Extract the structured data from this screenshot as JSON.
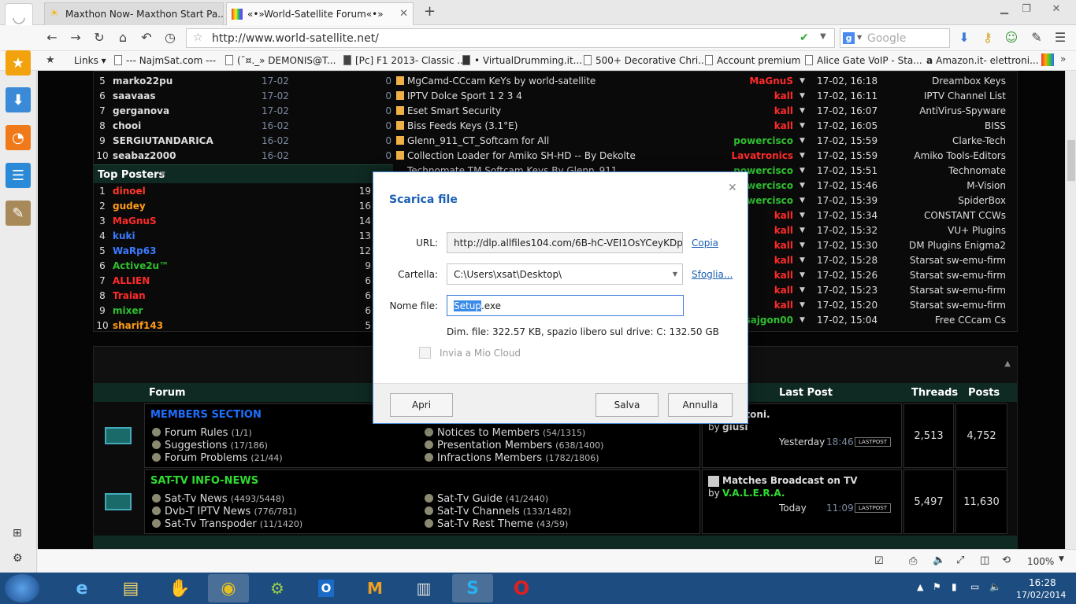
{
  "tabs": [
    {
      "title": "Maxthon Now- Maxthon Start Pa..."
    },
    {
      "title": "«•»World-Satellite Forum«•»"
    }
  ],
  "address": {
    "url": "http://www.world-satellite.net/"
  },
  "search": {
    "placeholder": "Google"
  },
  "bookmarks": [
    "Links",
    "--- NajmSat.com ---",
    "(¯¤._» DEMONIS@T...",
    "[Pc] F1 2013- Classic ...",
    "• VirtualDrumming.it...",
    "500+ Decorative Chri...",
    "Account premium",
    "Alice Gate VoIP - Sta...",
    "Amazon.it- elettroni..."
  ],
  "latest_rows": [
    {
      "num": "5",
      "user": "marko22pu",
      "date": "17-02",
      "count": "0",
      "topic": "MgCamd-CCcam KeYs by world-satellite",
      "poster": "MaGnuS",
      "poster_color": "#ff2a2a",
      "time": "17-02, 16:18",
      "forum": "Dreambox Keys"
    },
    {
      "num": "6",
      "user": "saavaas",
      "date": "17-02",
      "count": "0",
      "topic": "IPTV Dolce Sport 1 2 3 4",
      "poster": "kall",
      "poster_color": "#ff2a2a",
      "time": "17-02, 16:11",
      "forum": "IPTV Channel List"
    },
    {
      "num": "7",
      "user": "gerganova",
      "date": "17-02",
      "count": "0",
      "topic": "Eset Smart Security",
      "poster": "kall",
      "poster_color": "#ff2a2a",
      "time": "17-02, 16:07",
      "forum": "AntiVirus-Spyware"
    },
    {
      "num": "8",
      "user": "chooi",
      "date": "16-02",
      "count": "0",
      "topic": "Biss Feeds Keys (3.1°E)",
      "poster": "kall",
      "poster_color": "#ff2a2a",
      "time": "17-02, 16:05",
      "forum": "BISS"
    },
    {
      "num": "9",
      "user": "SERGIUTANDARICA",
      "date": "16-02",
      "count": "0",
      "topic": "Glenn_911_CT_Softcam for All",
      "poster": "powercisco",
      "poster_color": "#2fbf2f",
      "time": "17-02, 15:59",
      "forum": "Clarke-Tech"
    },
    {
      "num": "10",
      "user": "seabaz2000",
      "date": "16-02",
      "count": "0",
      "topic": "Collection Loader for Amiko SH-HD -- By Dekolte",
      "poster": "Lavatronics",
      "poster_color": "#ff2a2a",
      "time": "17-02, 15:59",
      "forum": "Amiko Tools-Editors"
    }
  ],
  "top_posters_title": "Top Posters",
  "top_posters": [
    {
      "num": "1",
      "name": "dinoel",
      "color": "#ff3a2a",
      "count": "19"
    },
    {
      "num": "2",
      "name": "gudey",
      "color": "#ff9a1a",
      "count": "16"
    },
    {
      "num": "3",
      "name": "MaGnuS",
      "color": "#ff2a2a",
      "count": "14"
    },
    {
      "num": "4",
      "name": "kuki",
      "color": "#3a7aff",
      "count": "13"
    },
    {
      "num": "5",
      "name": "WaRp63",
      "color": "#3a7aff",
      "count": "12"
    },
    {
      "num": "6",
      "name": "Active2u™",
      "color": "#2fbf2f",
      "count": "9"
    },
    {
      "num": "7",
      "name": "ALLIEN",
      "color": "#ff2a2a",
      "count": "6"
    },
    {
      "num": "8",
      "name": "Traian",
      "color": "#ff2a2a",
      "count": "6"
    },
    {
      "num": "9",
      "name": "mixer",
      "color": "#2fbf2f",
      "count": "6"
    },
    {
      "num": "10",
      "name": "sharif143",
      "color": "#ff9a1a",
      "count": "5"
    }
  ],
  "right_rows": [
    {
      "topic": "Technomate TM Softcam Keys By Glenn_911",
      "poster": "powercisco",
      "poster_color": "#2fbf2f",
      "time": "17-02, 15:51",
      "forum": "Technomate"
    },
    {
      "topic": "",
      "poster": "powercisco",
      "poster_color": "#2fbf2f",
      "time": "17-02, 15:46",
      "forum": "M-Vision"
    },
    {
      "topic": "",
      "poster": "powercisco",
      "poster_color": "#2fbf2f",
      "time": "17-02, 15:39",
      "forum": "SpiderBox"
    },
    {
      "topic": "",
      "poster": "kall",
      "poster_color": "#ff2a2a",
      "time": "17-02, 15:34",
      "forum": "CONSTANT CCWs"
    },
    {
      "topic": "",
      "poster": "kall",
      "poster_color": "#ff2a2a",
      "time": "17-02, 15:32",
      "forum": "VU+ Plugins"
    },
    {
      "topic": "",
      "poster": "kall",
      "poster_color": "#ff2a2a",
      "time": "17-02, 15:30",
      "forum": "DM Plugins Enigma2"
    },
    {
      "topic": "",
      "poster": "kall",
      "poster_color": "#ff2a2a",
      "time": "17-02, 15:28",
      "forum": "Starsat sw-emu-firm"
    },
    {
      "topic": "",
      "poster": "kall",
      "poster_color": "#ff2a2a",
      "time": "17-02, 15:26",
      "forum": "Starsat sw-emu-firm"
    },
    {
      "topic": "",
      "poster": "kall",
      "poster_color": "#ff2a2a",
      "time": "17-02, 15:23",
      "forum": "Starsat sw-emu-firm"
    },
    {
      "topic": "",
      "poster": "kall",
      "poster_color": "#ff2a2a",
      "time": "17-02, 15:20",
      "forum": "Starsat sw-emu-firm"
    },
    {
      "topic": "",
      "poster": "sajgon00",
      "poster_color": "#2fbf2f",
      "time": "17-02, 15:04",
      "forum": "Free CCcam Cs"
    }
  ],
  "forum_table": {
    "headers": {
      "forum": "Forum",
      "last_post": "Last Post",
      "threads": "Threads",
      "posts": "Posts"
    },
    "sections": [
      {
        "title": "MEMBERS SECTION",
        "title_color": "#1f6fff",
        "subs": [
          {
            "name": "Forum Rules",
            "count": "(1/1)"
          },
          {
            "name": "Suggestions",
            "count": "(17/186)"
          },
          {
            "name": "Forum Problems",
            "count": "(21/44)"
          },
          {
            "name": "Notices to Members",
            "count": "(54/1315)"
          },
          {
            "name": "Presentation Members",
            "count": "(638/1400)"
          },
          {
            "name": "Infractions Members",
            "count": "(1782/1806)"
          }
        ],
        "last_title": "Salutoni.",
        "last_by_label": "by",
        "last_by": "giusi",
        "last_by_color": "#dddddd",
        "last_day": "Yesterday",
        "last_time": "18:46",
        "last_badge": "LASTPOST",
        "threads": "2,513",
        "posts": "4,752"
      },
      {
        "title": "SAT-TV INFO-NEWS",
        "title_color": "#2fdc2f",
        "subs": [
          {
            "name": "Sat-Tv News",
            "count": "(4493/5448)"
          },
          {
            "name": "Dvb-T IPTV News",
            "count": "(776/781)"
          },
          {
            "name": "Sat-Tv Transpoder",
            "count": "(11/1420)"
          },
          {
            "name": "Sat-Tv Guide",
            "count": "(41/2440)"
          },
          {
            "name": "Sat-Tv Channels",
            "count": "(133/1482)"
          },
          {
            "name": "Sat-Tv Rest Theme",
            "count": "(43/59)"
          }
        ],
        "last_title": "Matches Broadcast on TV",
        "last_by_label": "by",
        "last_by": "V.A.L.E.R.A.",
        "last_by_color": "#2fdc2f",
        "last_day": "Today",
        "last_time": "11:09",
        "last_badge": "LASTPOST",
        "threads": "5,497",
        "posts": "11,630"
      }
    ]
  },
  "dialog": {
    "title": "Scarica file",
    "url_label": "URL:",
    "url_value": "http://dlp.allfiles104.com/6B-hC-VEI1OsYCeyKDpxuxg",
    "copy_link": "Copia",
    "folder_label": "Cartella:",
    "folder_value": "C:\\Users\\xsat\\Desktop\\",
    "browse_link": "Sfoglia...",
    "filename_label": "Nome file:",
    "filename_selected": "Setup",
    "filename_rest": ".exe",
    "size_info": "Dim. file: 322.57 KB, spazio libero sul drive: C: 132.50 GB",
    "cloud_label": "Invia a Mio Cloud",
    "open_button": "Apri",
    "save_button": "Salva",
    "cancel_button": "Annulla"
  },
  "statusbar": {
    "zoom": "100%"
  },
  "clock": {
    "time": "16:28",
    "date": "17/02/2014"
  }
}
